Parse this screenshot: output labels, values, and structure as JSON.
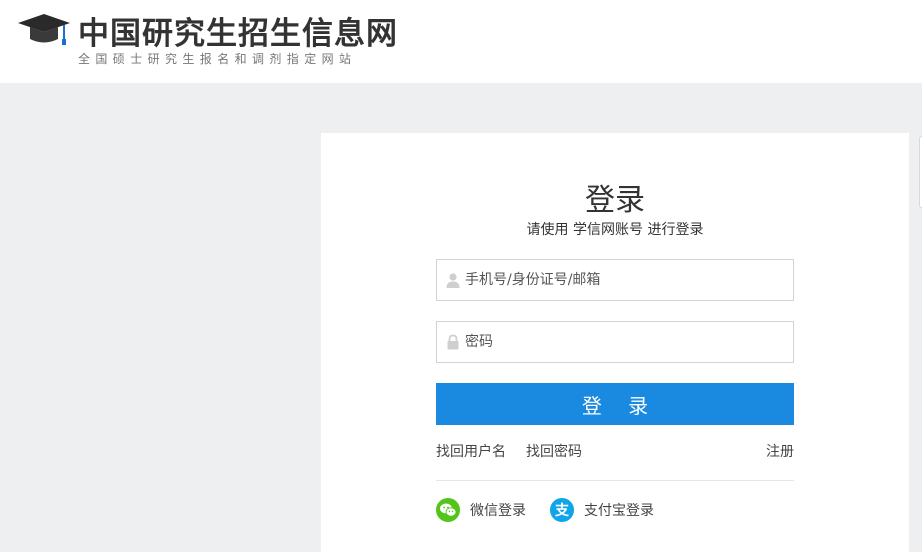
{
  "header": {
    "title": "中国研究生招生信息网",
    "subtitle": "全国硕士研究生报名和调剂指定网站"
  },
  "login": {
    "title": "登录",
    "subtitle": "请使用 学信网账号 进行登录",
    "username_placeholder": "手机号/身份证号/邮箱",
    "password_placeholder": "密码",
    "submit_label": "登 录",
    "find_username": "找回用户名",
    "find_password": "找回密码",
    "register": "注册",
    "wechat_login": "微信登录",
    "alipay_login": "支付宝登录",
    "alipay_glyph": "支"
  },
  "colors": {
    "primary_button": "#1a89e0",
    "wechat": "#52c41a",
    "alipay": "#0ea5e9",
    "page_background": "#eeeff1"
  },
  "icons": [
    "graduation-cap-icon",
    "user-icon",
    "lock-icon",
    "wechat-icon",
    "alipay-icon"
  ]
}
